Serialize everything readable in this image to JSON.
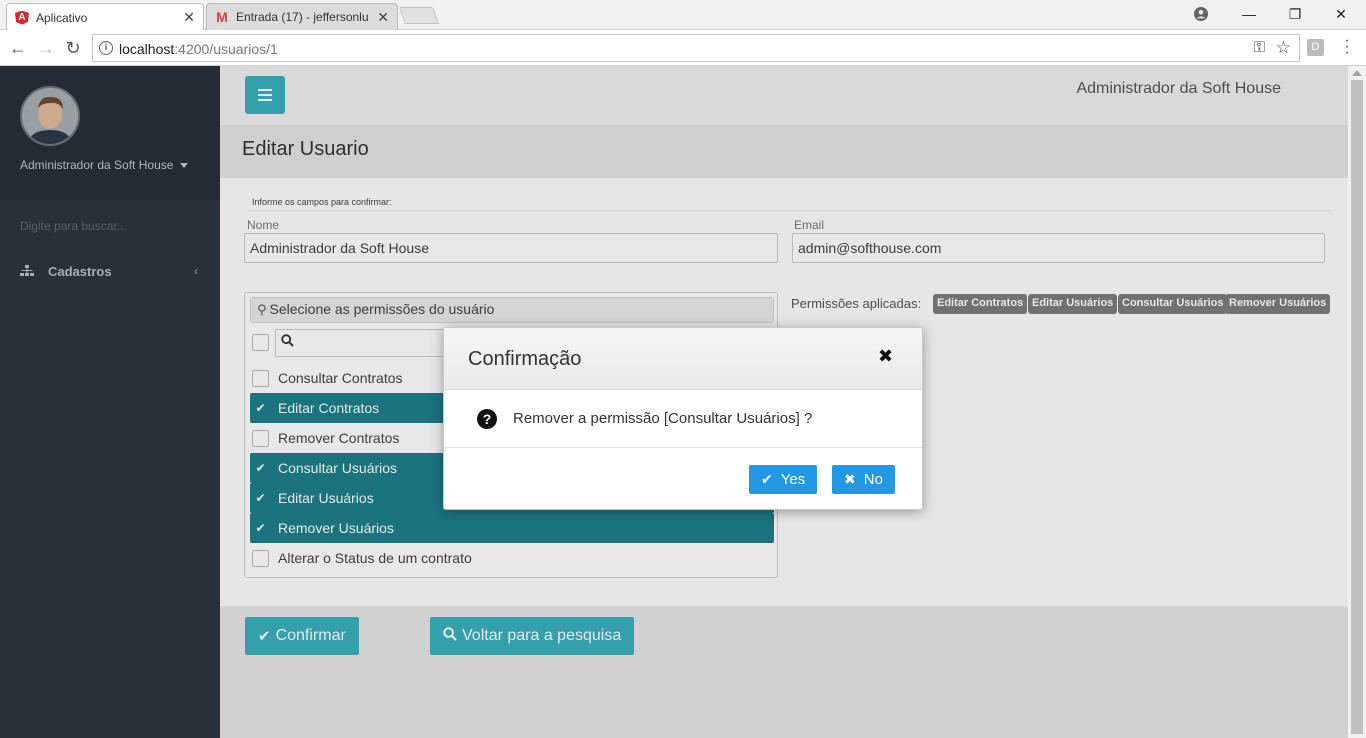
{
  "browser": {
    "tabs": [
      {
        "title": "Aplicativo",
        "active": true,
        "favicon": "angular-icon"
      },
      {
        "title": "Entrada (17) - jeffersonlu",
        "active": false,
        "favicon": "gmail-icon"
      }
    ],
    "url_host": "localhost",
    "url_path": ":4200/usuarios/1",
    "extension_label": "D"
  },
  "sidebar": {
    "user_name": "Administrador da Soft House",
    "search_placeholder": "Digite para buscar...",
    "items": [
      {
        "label": "Cadastros",
        "icon": "sitemap-icon"
      }
    ]
  },
  "topbar": {
    "user_label": "Administrador da Soft House"
  },
  "page": {
    "title": "Editar Usuario",
    "hint": "Informe os campos para confirmar:",
    "fields": {
      "name_label": "Nome",
      "name_value": "Administrador da Soft House",
      "email_label": "Email",
      "email_value": "admin@softhouse.com"
    },
    "picklist": {
      "header": "Selecione as permissões do usuário",
      "items": [
        {
          "label": "Consultar Contratos",
          "selected": false
        },
        {
          "label": "Editar Contratos",
          "selected": true
        },
        {
          "label": "Remover Contratos",
          "selected": false
        },
        {
          "label": "Consultar Usuários",
          "selected": true
        },
        {
          "label": "Editar Usuários",
          "selected": true
        },
        {
          "label": "Remover Usuários",
          "selected": true
        },
        {
          "label": "Alterar o Status de um contrato",
          "selected": false
        }
      ]
    },
    "applied": {
      "label": "Permissões aplicadas:",
      "badges": [
        "Editar Contratos",
        "Editar Usuários",
        "Consultar Usuários",
        "Remover Usuários"
      ]
    },
    "buttons": {
      "confirm": "Confirmar",
      "back": "Voltar para a pesquisa"
    }
  },
  "dialog": {
    "title": "Confirmação",
    "message": "Remover a permissão [Consultar Usuários] ?",
    "yes": "Yes",
    "no": "No"
  },
  "colors": {
    "accent": "#3ab0bd",
    "selected": "#1e7f8b",
    "dialog_button": "#2399e5",
    "sidebar": "#2b3640"
  }
}
